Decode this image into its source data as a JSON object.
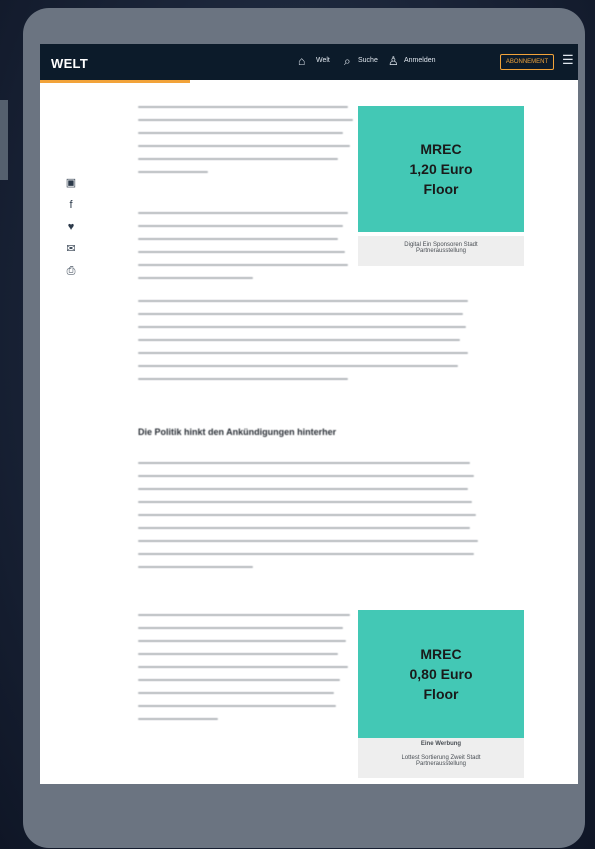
{
  "header": {
    "logo": "WELT",
    "nav": [
      "Welt",
      "Suche",
      "Anmelden"
    ],
    "subscribe_label": "ABONNEMENT"
  },
  "article": {
    "section_heading": "Die Politik hinkt den Ankündigungen hinterher"
  },
  "ads": [
    {
      "line1": "MREC",
      "line2": "1,20 Euro",
      "line3": "Floor",
      "caption": "Digital Ein Sponsoren Stadt\nPartnerausstellung"
    },
    {
      "line1": "MREC",
      "line2": "0,80 Euro",
      "line3": "Floor",
      "caption_top": "Eine Werbung",
      "caption": "Lottest Sortierung Zweit Stadt\nPartnerausstellung"
    }
  ],
  "colors": {
    "navbar": "#0c1b2a",
    "accent": "#f2a33a",
    "ad_fill": "#43c8b5",
    "device_frame": "#6b7481"
  },
  "icons": {
    "share": [
      "save-icon",
      "facebook-icon",
      "twitter-icon",
      "mail-icon",
      "print-icon"
    ],
    "nav": [
      "home-icon",
      "search-icon",
      "user-icon",
      "menu-icon"
    ]
  }
}
